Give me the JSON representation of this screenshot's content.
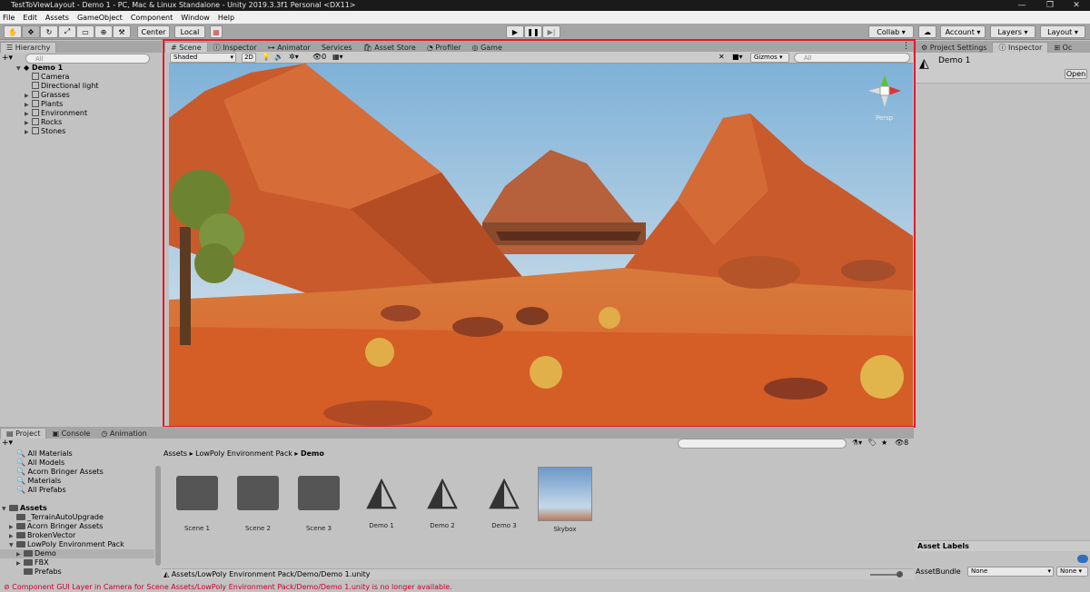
{
  "window": {
    "title": "TestToViewLayout - Demo 1 - PC, Mac & Linux Standalone - Unity 2019.3.3f1 Personal <DX11>",
    "minimize": "—",
    "maximize": "❐",
    "close": "✕"
  },
  "menu": [
    "File",
    "Edit",
    "Assets",
    "GameObject",
    "Component",
    "Window",
    "Help"
  ],
  "toolbar": {
    "pivot_label": "Center",
    "space_label": "Local",
    "collab_label": "Collab ▾",
    "account_label": "Account",
    "layers_label": "Layers",
    "layout_label": "Layout"
  },
  "hierarchy": {
    "tab": "Hierarchy",
    "search_placeholder": "All",
    "scene": "Demo 1",
    "items": [
      "Camera",
      "Directional light",
      "Grasses",
      "Plants",
      "Environment",
      "Rocks",
      "Stones"
    ]
  },
  "center_tabs": [
    "Scene",
    "Inspector",
    "Animator",
    "Services",
    "Asset Store",
    "Profiler",
    "Game"
  ],
  "scene_toolbar": {
    "shading": "Shaded",
    "mode_2d": "2D",
    "hidden_count": "0",
    "gizmos": "Gizmos",
    "search_placeholder": "All",
    "persp_label": "Persp"
  },
  "right_tabs": {
    "project_settings": "Project Settings",
    "inspector": "Inspector",
    "other": "Oc"
  },
  "inspector": {
    "object_name": "Demo 1",
    "open_button": "Open",
    "asset_labels": "Asset Labels",
    "asset_bundle_label": "AssetBundle",
    "asset_bundle_value": "None",
    "variant_value": "None"
  },
  "bottom_tabs": [
    "Project",
    "Console",
    "Animation"
  ],
  "project": {
    "favorites": [
      "All Materials",
      "All Models",
      "Acorn Bringer Assets",
      "Materials",
      "All Prefabs"
    ],
    "assets_root": "Assets",
    "assets": [
      "_TerrainAutoUpgrade",
      "Acorn Bringer Assets",
      "BrokenVector",
      "LowPoly Environment Pack",
      "Demo",
      "FBX",
      "Prefabs"
    ],
    "breadcrumb": [
      "Assets",
      "LowPoly Environment Pack",
      "Demo"
    ],
    "items": [
      "Scene 1",
      "Scene 2",
      "Scene 3",
      "Demo 1",
      "Demo 2",
      "Demo 3",
      "Skybox"
    ],
    "footer_path": "Assets/LowPoly Environment Pack/Demo/Demo 1.unity",
    "hidden_count": "8"
  },
  "status": {
    "message": "Component GUI Layer in Camera for Scene Assets/LowPoly Environment Pack/Demo/Demo 1.unity is no longer available."
  },
  "colors": {
    "highlight_border": "#e11d2a",
    "sky": "#b9d6ea",
    "terrain": "#d9662c",
    "status_error": "#c8002a"
  }
}
